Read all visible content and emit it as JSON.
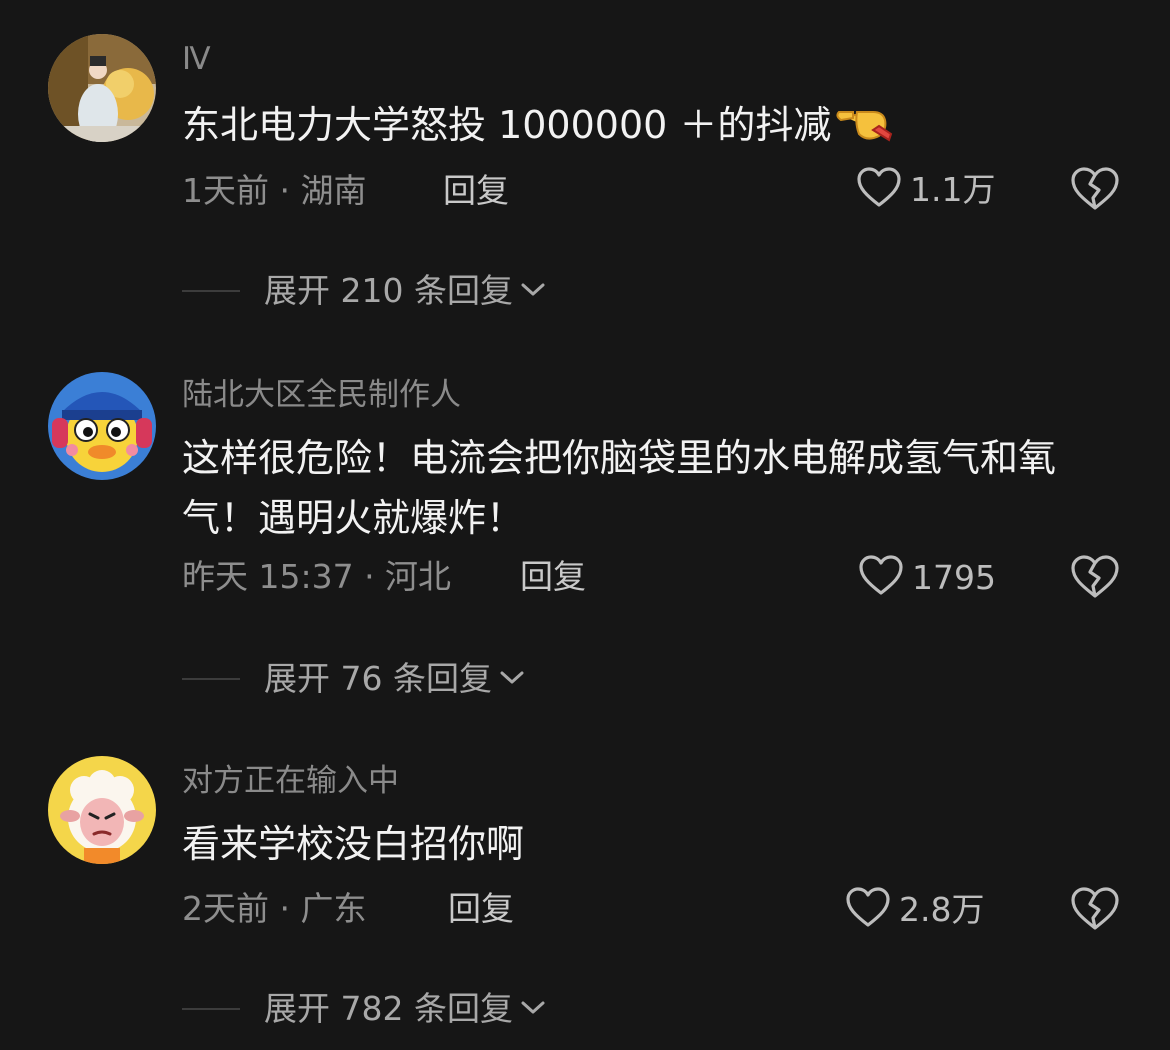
{
  "comments": [
    {
      "username": "Ⅳ",
      "text": "东北电力大学怒投 1000000 ＋的抖减",
      "emoji": "pointing-hand-emoji",
      "time_location": "1天前 · 湖南",
      "reply_label": "回复",
      "likes": "1.1万",
      "expand_label": "展开 210 条回复"
    },
    {
      "username": "陆北大区全民制作人",
      "text": "这样很危险！电流会把你脑袋里的水电解成氢气和氧气！遇明火就爆炸！",
      "time_location": "昨天 15:37 · 河北",
      "reply_label": "回复",
      "likes": "1795",
      "expand_label": "展开 76 条回复"
    },
    {
      "username": "对方正在输入中",
      "text": "看来学校没白招你啊",
      "time_location": "2天前 · 广东",
      "reply_label": "回复",
      "likes": "2.8万",
      "expand_label": "展开 782 条回复"
    }
  ],
  "colors": {
    "background": "#161616",
    "username": "#8a8a8a",
    "body_text": "#f2f2f2",
    "meta": "#8e8e8e",
    "reply": "#c9c9c9"
  },
  "icons": {
    "like": "heart-outline-icon",
    "dislike": "broken-heart-icon",
    "expand": "chevron-down-icon"
  }
}
